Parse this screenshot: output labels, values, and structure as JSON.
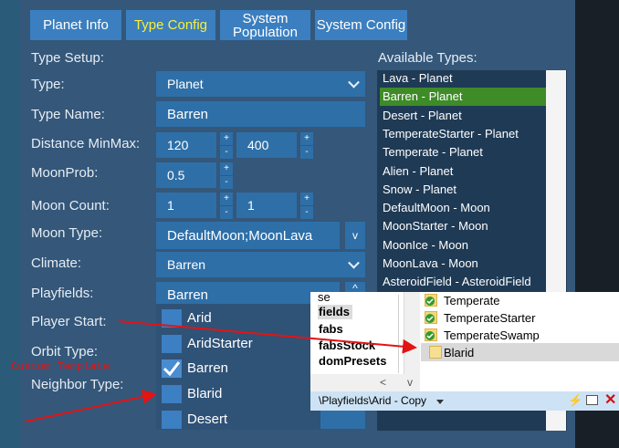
{
  "tabs": [
    {
      "label": "Planet Info",
      "active": false
    },
    {
      "label": "Type Config",
      "active": true
    },
    {
      "label": "System\nPopulation",
      "active": false
    },
    {
      "label": "System Config",
      "active": false
    }
  ],
  "type_setup": {
    "heading": "Type Setup:",
    "type_label": "Type:",
    "type_value": "Planet",
    "type_name_label": "Type Name:",
    "type_name_value": "Barren",
    "distance_label": "Distance MinMax:",
    "distance_min": "120",
    "distance_max": "400",
    "moonprob_label": "MoonProb:",
    "moonprob_value": "0.5",
    "mooncount_label": "Moon Count:",
    "mooncount_min": "1",
    "mooncount_max": "1",
    "moontype_label": "Moon Type:",
    "moontype_value": "DefaultMoon;MoonLava",
    "moontype_btn": "v",
    "climate_label": "Climate:",
    "climate_value": "Barren",
    "playfields_label": "Playfields:",
    "playfields_value": "Barren",
    "playfields_btn": "^",
    "player_start_label": "Player Start:",
    "orbit_type_label": "Orbit Type:",
    "neighbor_type_label": "Neighbor Type:",
    "spin_plus": "+",
    "spin_minus": "-"
  },
  "playfield_dropdown": {
    "items": [
      {
        "label": "Arid",
        "checked": false
      },
      {
        "label": "AridStarter",
        "checked": false
      },
      {
        "label": "Barren",
        "checked": true
      },
      {
        "label": "Blarid",
        "checked": false
      },
      {
        "label": "Desert",
        "checked": false
      }
    ]
  },
  "available_types": {
    "heading": "Available Types:",
    "selected_index": 1,
    "items": [
      "Lava - Planet",
      "Barren - Planet",
      "Desert - Planet",
      "TemperateStarter - Planet",
      "Temperate - Planet",
      "Alien - Planet",
      "Snow - Planet",
      "DefaultMoon - Moon",
      "MoonStarter - Moon",
      "MoonIce - Moon",
      "MoonLava - Moon",
      "AsteroidField - AsteroidField"
    ]
  },
  "explorer": {
    "left_items": [
      "se",
      "fields",
      "fabs",
      "fabsStock",
      "domPresets"
    ],
    "right_items": [
      "Temperate",
      "TemperateStarter",
      "TemperateSwamp",
      "Blarid"
    ],
    "address": "\\Playfields\\Arid - Copy",
    "scroll_left": "<",
    "scroll_down": "v"
  },
  "annotation": {
    "text": "Custom Template",
    "color": "#e21414"
  },
  "colors": {
    "tab_bg": "#3b7fc0",
    "active_tab_text": "#f7f03c",
    "selected_item": "#3e8b28",
    "field_bg": "#2e6fa8"
  }
}
